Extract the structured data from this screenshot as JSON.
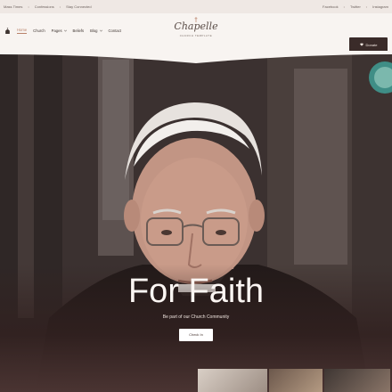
{
  "topbar": {
    "left_links": [
      "Mass Times",
      "Confessions",
      "Stay Connected"
    ],
    "right_links": [
      "Facebook",
      "Twitter",
      "Instagram"
    ]
  },
  "nav": {
    "items": [
      {
        "label": "Home",
        "active": true,
        "dropdown": false
      },
      {
        "label": "Church",
        "active": false,
        "dropdown": false
      },
      {
        "label": "Pages",
        "active": false,
        "dropdown": true
      },
      {
        "label": "Beliefs",
        "active": false,
        "dropdown": false
      },
      {
        "label": "Blog",
        "active": false,
        "dropdown": true
      },
      {
        "label": "Contact",
        "active": false,
        "dropdown": false
      }
    ]
  },
  "logo": {
    "word": "Chapelle",
    "subtitle": "CHURCH TEMPLATE"
  },
  "donate": {
    "label": "Donate"
  },
  "hero": {
    "title": "For Faith",
    "subtitle": "Be part of our Church Community",
    "button_label": "Check In"
  },
  "colors": {
    "accent": "#b9826a",
    "dark": "#3a2b29",
    "background": "#f4efec"
  }
}
